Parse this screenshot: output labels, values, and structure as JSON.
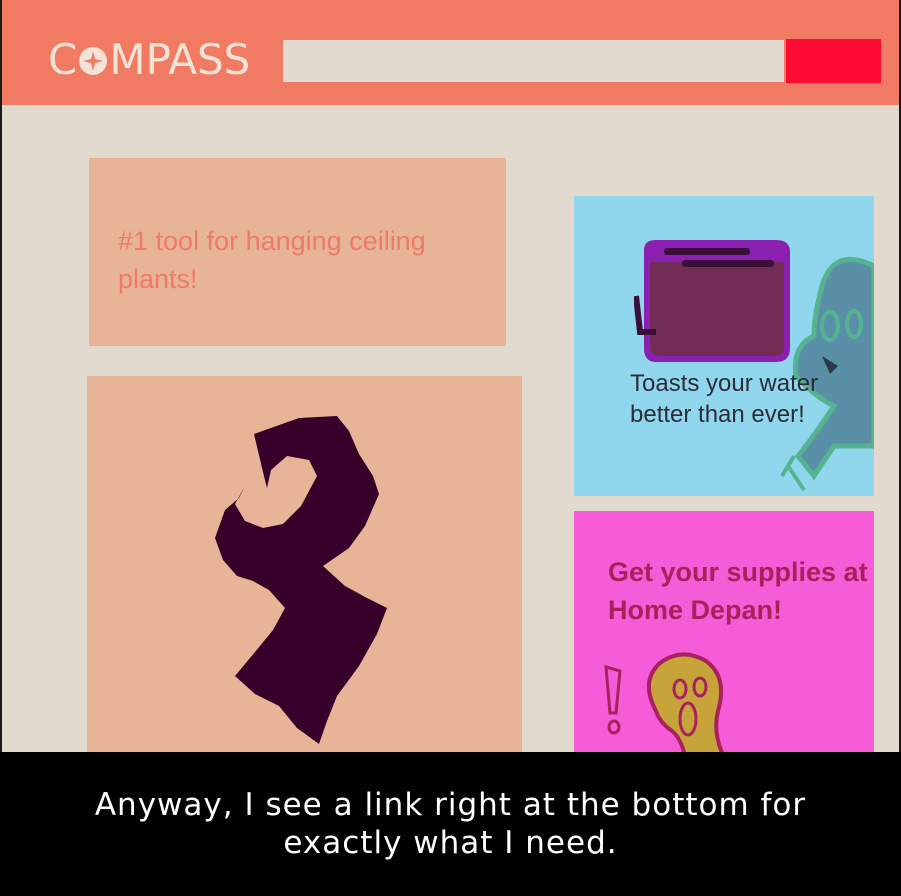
{
  "header": {
    "logo_text_start": "C",
    "logo_text_end": "MPASS",
    "logo_icon": "compass-rose-icon",
    "search_value": "",
    "colors": {
      "header": "#f17a62",
      "search_button": "#ff0a33",
      "page": "#e2dace"
    }
  },
  "main": {
    "card_tagline": "#1 tool for hanging ceiling plants!",
    "card_image_icon": "hook-tool-silhouette"
  },
  "ads": {
    "toaster": {
      "text": "Toasts your water better than ever!",
      "icons": [
        "toaster-icon",
        "scared-ghost-icon"
      ],
      "background": "#90d6ec"
    },
    "supplies": {
      "text": "Get your supplies at Home Depan!",
      "icons": [
        "exclamation-icon",
        "screaming-blob-icon"
      ],
      "background": "#f75cd8"
    }
  },
  "caption": {
    "line1": "Anyway, I see a link right at the bottom for",
    "line2": "exactly what I need."
  }
}
